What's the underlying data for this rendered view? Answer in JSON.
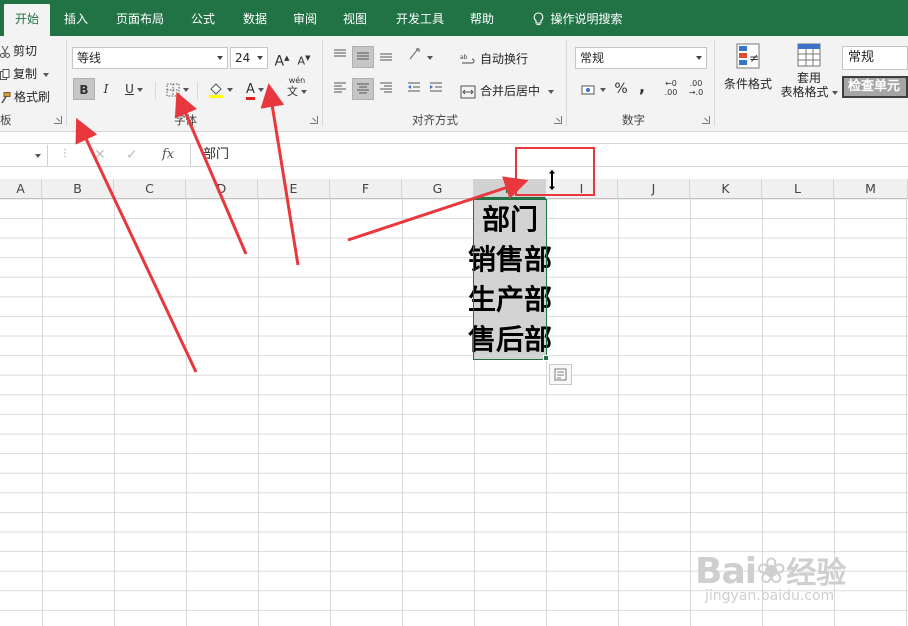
{
  "ribbon_tabs": [
    "开始",
    "插入",
    "页面布局",
    "公式",
    "数据",
    "审阅",
    "视图",
    "开发工具",
    "帮助",
    "操作说明搜索"
  ],
  "clipboard": {
    "cut": "剪切",
    "copy": "复制",
    "format_painter": "格式刷",
    "group_label": "板"
  },
  "font": {
    "font_name": "等线",
    "font_size": "24",
    "grow": "A",
    "shrink": "A",
    "bold": "B",
    "italic": "I",
    "underline": "U",
    "font_color_letter": "A",
    "phonetic_top": "wén",
    "phonetic_bottom": "文",
    "group_label": "字体"
  },
  "alignment": {
    "wrap_text": "自动换行",
    "merge_center": "合并后居中",
    "group_label": "对齐方式"
  },
  "number": {
    "format": "常规",
    "percent": "%",
    "comma": ",",
    "inc_decimal_top": "←0",
    "inc_decimal_bottom": ".00",
    "dec_decimal_top": ".00",
    "dec_decimal_bottom": "→.0",
    "group_label": "数字"
  },
  "styles": {
    "conditional": "条件格式",
    "table_top": "套用",
    "table_bottom": "表格格式",
    "style_normal": "常规",
    "style_check": "检查单元"
  },
  "formula_bar": {
    "fx": "fx",
    "content": "部门"
  },
  "columns": [
    "A",
    "B",
    "C",
    "D",
    "E",
    "F",
    "G",
    "H",
    "I",
    "J",
    "K",
    "L",
    "M"
  ],
  "selected_column": "H",
  "cells": [
    "部门",
    "销售部",
    "生产部",
    "售后部"
  ],
  "watermark": {
    "logo": "Bai",
    "logo_suffix": "经验",
    "url": "jingyan.baidu.com"
  },
  "colors": {
    "excel_green": "#217346",
    "annotation_red": "#e8383d",
    "selection_fill": "#d3d3d3"
  }
}
